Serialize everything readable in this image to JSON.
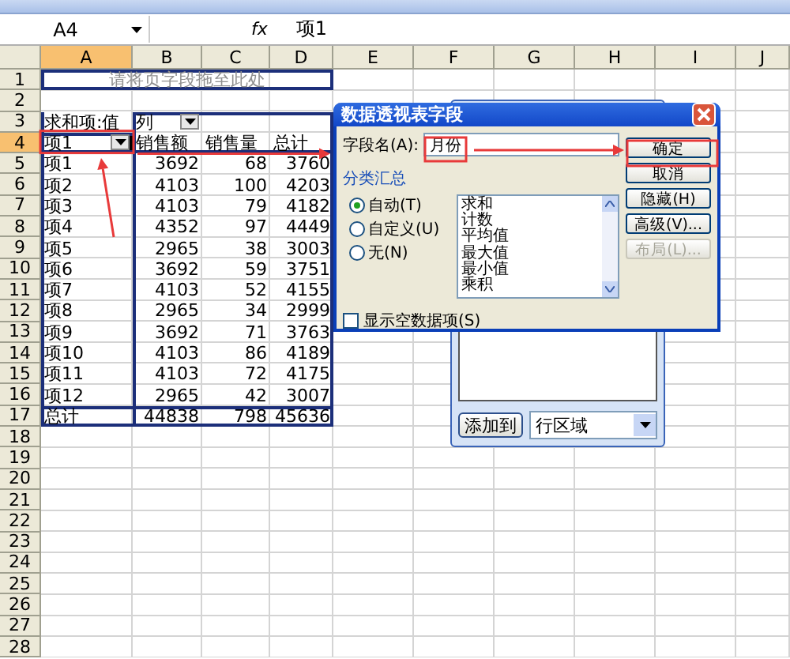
{
  "formula_bar": {
    "name_box": "A4",
    "function_label": "fx",
    "formula": "项1"
  },
  "columns": [
    {
      "label": "A",
      "selected": true
    },
    {
      "label": "B",
      "selected": false
    },
    {
      "label": "C",
      "selected": false
    },
    {
      "label": "D",
      "selected": false
    },
    {
      "label": "E",
      "selected": false
    },
    {
      "label": "F",
      "selected": false
    },
    {
      "label": "G",
      "selected": false
    },
    {
      "label": "H",
      "selected": false
    },
    {
      "label": "I",
      "selected": false
    },
    {
      "label": "J",
      "selected": false
    }
  ],
  "row_numbers": [
    {
      "label": "1",
      "selected": false
    },
    {
      "label": "2",
      "selected": false
    },
    {
      "label": "3",
      "selected": false
    },
    {
      "label": "4",
      "selected": true
    },
    {
      "label": "5",
      "selected": false
    },
    {
      "label": "6",
      "selected": false
    },
    {
      "label": "7",
      "selected": false
    },
    {
      "label": "8",
      "selected": false
    },
    {
      "label": "9",
      "selected": false
    },
    {
      "label": "10",
      "selected": false
    },
    {
      "label": "11",
      "selected": false
    },
    {
      "label": "12",
      "selected": false
    },
    {
      "label": "13",
      "selected": false
    },
    {
      "label": "14",
      "selected": false
    },
    {
      "label": "15",
      "selected": false
    },
    {
      "label": "16",
      "selected": false
    },
    {
      "label": "17",
      "selected": false
    },
    {
      "label": "18",
      "selected": false
    },
    {
      "label": "19",
      "selected": false
    },
    {
      "label": "20",
      "selected": false
    },
    {
      "label": "21",
      "selected": false
    },
    {
      "label": "22",
      "selected": false
    },
    {
      "label": "23",
      "selected": false
    },
    {
      "label": "24",
      "selected": false
    },
    {
      "label": "25",
      "selected": false
    },
    {
      "label": "26",
      "selected": false
    },
    {
      "label": "27",
      "selected": false
    },
    {
      "label": "28",
      "selected": false
    }
  ],
  "pivot": {
    "page_drop_hint": "请将页字段拖至此处",
    "data_label": "求和项:值",
    "column_field": "列",
    "row_field": "项1",
    "headers": [
      "销售额",
      "销售量",
      "总计"
    ],
    "rows": [
      {
        "label": "项1",
        "values": [
          "3692",
          "68",
          "3760"
        ]
      },
      {
        "label": "项2",
        "values": [
          "4103",
          "100",
          "4203"
        ]
      },
      {
        "label": "项3",
        "values": [
          "4103",
          "79",
          "4182"
        ]
      },
      {
        "label": "项4",
        "values": [
          "4352",
          "97",
          "4449"
        ]
      },
      {
        "label": "项5",
        "values": [
          "2965",
          "38",
          "3003"
        ]
      },
      {
        "label": "项6",
        "values": [
          "3692",
          "59",
          "3751"
        ]
      },
      {
        "label": "项7",
        "values": [
          "4103",
          "52",
          "4155"
        ]
      },
      {
        "label": "项8",
        "values": [
          "2965",
          "34",
          "2999"
        ]
      },
      {
        "label": "项9",
        "values": [
          "3692",
          "71",
          "3763"
        ]
      },
      {
        "label": "项10",
        "values": [
          "4103",
          "86",
          "4189"
        ]
      },
      {
        "label": "项11",
        "values": [
          "4103",
          "72",
          "4175"
        ]
      },
      {
        "label": "项12",
        "values": [
          "2965",
          "42",
          "3007"
        ]
      }
    ],
    "total": {
      "label": "总计",
      "values": [
        "44838",
        "798",
        "45636"
      ]
    }
  },
  "field_list_panel": {
    "add_button": "添加到",
    "area_select": "行区域"
  },
  "dialog": {
    "title": "数据透视表字段",
    "field_label": "字段名(A):",
    "field_value": "月份",
    "buttons": [
      {
        "label": "确定",
        "disabled": false
      },
      {
        "label": "取消",
        "disabled": false
      },
      {
        "label": "隐藏(H)",
        "disabled": false
      },
      {
        "label": "高级(V)...",
        "disabled": false
      },
      {
        "label": "布局(L)...",
        "disabled": true
      }
    ],
    "subtotal_label": "分类汇总",
    "subtotal_options": [
      {
        "label": "自动(T)",
        "selected": true
      },
      {
        "label": "自定义(U)",
        "selected": false
      },
      {
        "label": "无(N)",
        "selected": false
      }
    ],
    "functions": [
      "求和",
      "计数",
      "平均值",
      "最大值",
      "最小值",
      "乘积"
    ],
    "show_empty": {
      "label": "显示空数据项(S)",
      "checked": false
    }
  }
}
